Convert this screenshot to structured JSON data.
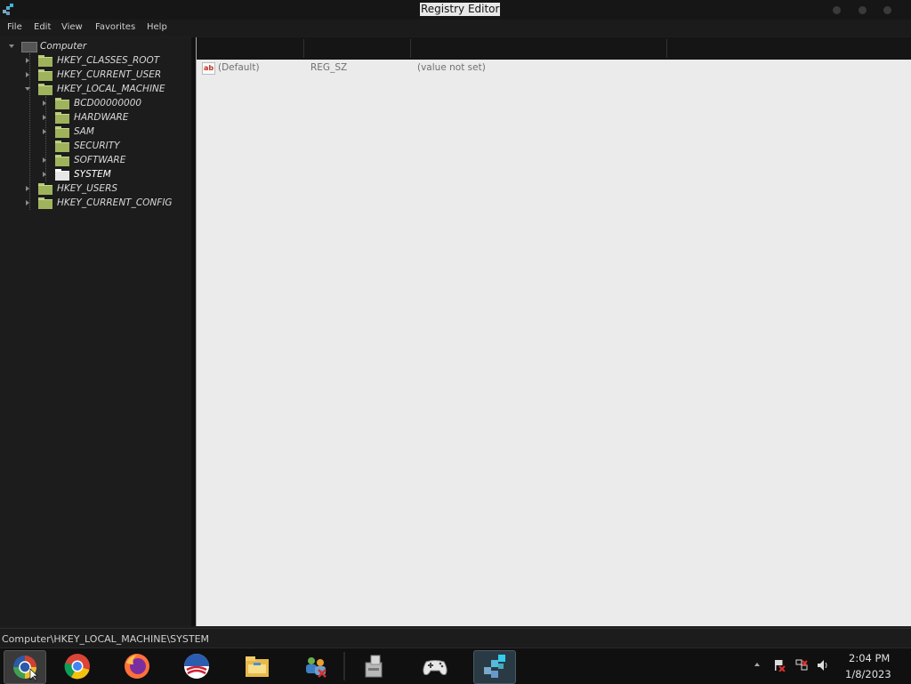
{
  "window": {
    "title": "Registry Editor",
    "icon": "regedit-icon"
  },
  "menu": [
    "File",
    "Edit",
    "View",
    "Favorites",
    "Help"
  ],
  "tree": {
    "root": "Computer",
    "hives": [
      {
        "label": "HKEY_CLASSES_ROOT",
        "expanded": false
      },
      {
        "label": "HKEY_CURRENT_USER",
        "expanded": false
      },
      {
        "label": "HKEY_LOCAL_MACHINE",
        "expanded": true
      },
      {
        "label": "HKEY_USERS",
        "expanded": false
      },
      {
        "label": "HKEY_CURRENT_CONFIG",
        "expanded": false
      }
    ],
    "hklm_children": [
      {
        "label": "BCD00000000",
        "expandable": true
      },
      {
        "label": "HARDWARE",
        "expandable": true
      },
      {
        "label": "SAM",
        "expandable": true
      },
      {
        "label": "SECURITY",
        "expandable": false
      },
      {
        "label": "SOFTWARE",
        "expandable": true
      },
      {
        "label": "SYSTEM",
        "expandable": true,
        "selected": true
      }
    ]
  },
  "list": {
    "columns": [
      "",
      "",
      ""
    ],
    "rows": [
      {
        "icon": "string-value-icon",
        "icon_text": "ab",
        "name": "(Default)",
        "type": "REG_SZ",
        "data": "(value not set)"
      }
    ]
  },
  "status": {
    "path": "Computer\\HKEY_LOCAL_MACHINE\\SYSTEM"
  },
  "taskbar": {
    "apps": [
      {
        "name": "start-orb-icon",
        "state": "hover"
      },
      {
        "name": "chrome-icon",
        "state": "pinned"
      },
      {
        "name": "firefox-icon",
        "state": "pinned"
      },
      {
        "name": "obama-logo-icon",
        "state": "pinned"
      },
      {
        "name": "file-explorer-icon",
        "state": "pinned"
      },
      {
        "name": "network-connections-icon",
        "state": "pinned"
      },
      {
        "name": "vault-drive-icon",
        "state": "pinned"
      },
      {
        "name": "gamepad-icon",
        "state": "pinned"
      },
      {
        "name": "regedit-icon",
        "state": "active"
      }
    ],
    "tray": [
      "show-hidden-icons-chevron",
      "action-center-flag-icon",
      "network-icon",
      "volume-icon"
    ],
    "clock": {
      "time": "2:04 PM",
      "date": "1/8/2023"
    }
  },
  "colors": {
    "background": "#1e1e1e",
    "list_background": "#ebebeb",
    "folder": "#9fb35d",
    "selected_folder": "#e7e7e7"
  }
}
